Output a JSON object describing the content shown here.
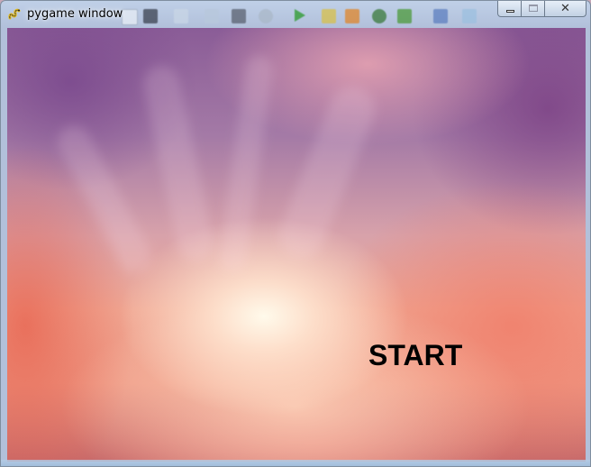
{
  "window": {
    "title": "pygame window",
    "controls": {
      "minimize_icon": "minimize-icon",
      "maximize_icon": "maximize-icon",
      "close_icon": "close-icon",
      "close_glyph": "✕"
    }
  },
  "app_icon": "pygame-snake-icon",
  "game": {
    "start_label": "START"
  },
  "colors": {
    "glass": "#b8d2ec",
    "background_top": "#8a5c97",
    "background_mid": "#f0a894",
    "background_bottom": "#c86a6a",
    "text": "#000000"
  }
}
